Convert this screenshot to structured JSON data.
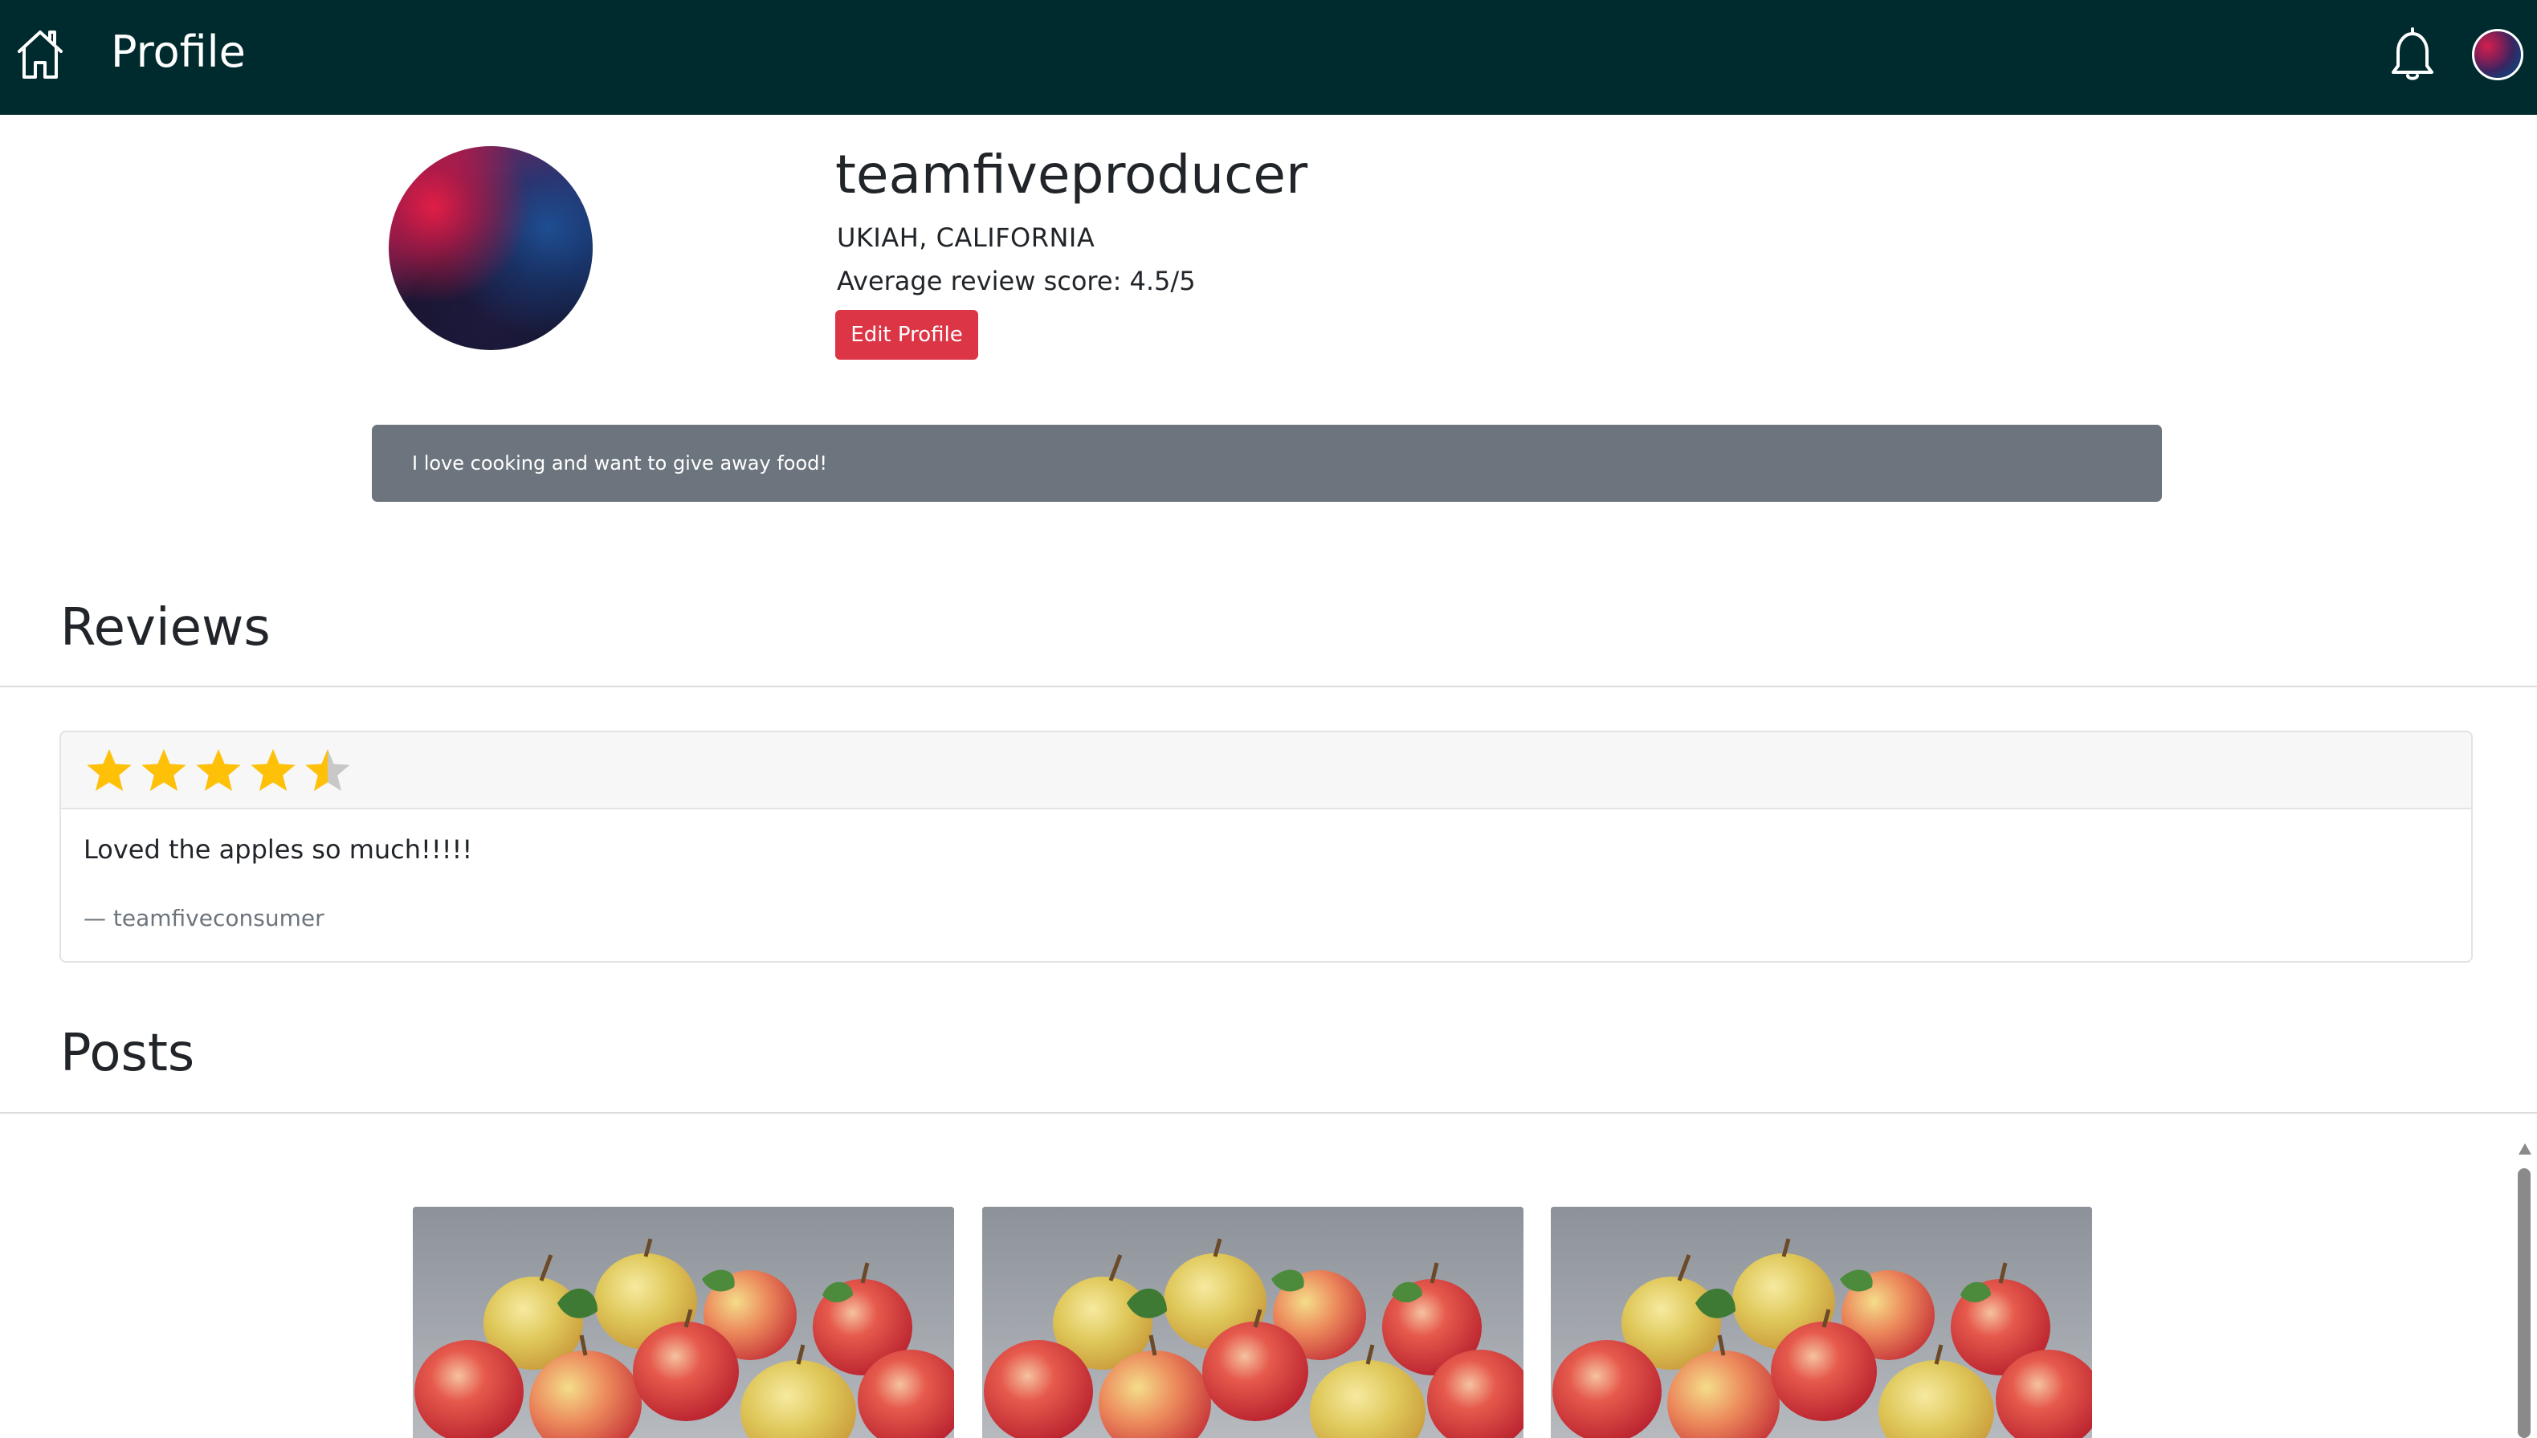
{
  "navbar": {
    "title": "Profile",
    "background": "#002b2e",
    "icons": [
      "home-icon",
      "bell-icon",
      "avatar"
    ]
  },
  "profile": {
    "username": "teamfiveproducer",
    "location": "UKIAH, CALIFORNIA",
    "average_review": "Average review score: 4.5/5",
    "edit_label": "Edit Profile",
    "edit_color": "#dc3545",
    "bio": "I love cooking and want to give away food!"
  },
  "reviews": {
    "title": "Reviews",
    "items": [
      {
        "rating": 4.5,
        "max_rating": 5,
        "text": "Loved the apples so much!!!!!",
        "author": "— teamfiveconsumer"
      }
    ]
  },
  "posts": {
    "title": "Posts",
    "items": [
      {
        "image": "apples-photo"
      },
      {
        "image": "apples-photo"
      },
      {
        "image": "apples-photo"
      }
    ]
  },
  "colors": {
    "star": "#ffc107",
    "star_empty": "#c8c8c8",
    "bio_bg": "#6c757d"
  }
}
